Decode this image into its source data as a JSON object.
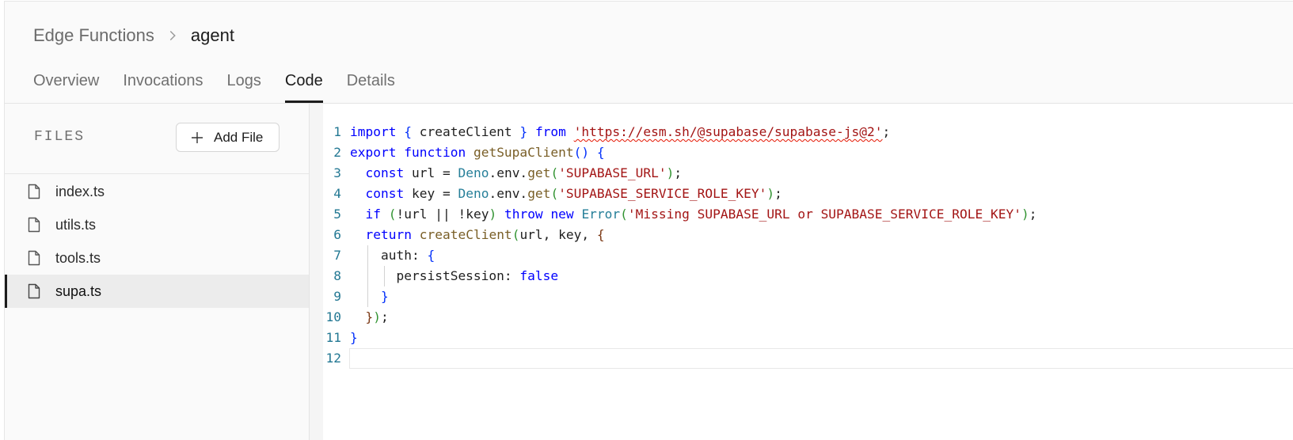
{
  "breadcrumb": {
    "root": "Edge Functions",
    "current": "agent"
  },
  "tabs": [
    {
      "label": "Overview",
      "active": false
    },
    {
      "label": "Invocations",
      "active": false
    },
    {
      "label": "Logs",
      "active": false
    },
    {
      "label": "Code",
      "active": true
    },
    {
      "label": "Details",
      "active": false
    }
  ],
  "sidebar": {
    "title": "FILES",
    "add_file_label": "Add File",
    "files": [
      {
        "name": "index.ts",
        "active": false
      },
      {
        "name": "utils.ts",
        "active": false
      },
      {
        "name": "tools.ts",
        "active": false
      },
      {
        "name": "supa.ts",
        "active": true
      }
    ]
  },
  "editor": {
    "line_numbers": [
      "1",
      "2",
      "3",
      "4",
      "5",
      "6",
      "7",
      "8",
      "9",
      "10",
      "11",
      "12"
    ],
    "lines": [
      "import { createClient } from 'https://esm.sh/@supabase/supabase-js@2';",
      "export function getSupaClient() {",
      "  const url = Deno.env.get('SUPABASE_URL');",
      "  const key = Deno.env.get('SUPABASE_SERVICE_ROLE_KEY');",
      "  if (!url || !key) throw new Error('Missing SUPABASE_URL or SUPABASE_SERVICE_ROLE_KEY');",
      "  return createClient(url, key, {",
      "    auth: {",
      "      persistSession: false",
      "    }",
      "  });",
      "}",
      ""
    ]
  },
  "colors": {
    "keyword": "#0000ff",
    "string": "#a31515",
    "type": "#267f99",
    "line_number": "#237893",
    "active_tab_underline": "#1c1c1c"
  },
  "icons": {
    "breadcrumb_separator": "chevron-right-icon",
    "add_file": "plus-icon",
    "file": "file-icon"
  }
}
